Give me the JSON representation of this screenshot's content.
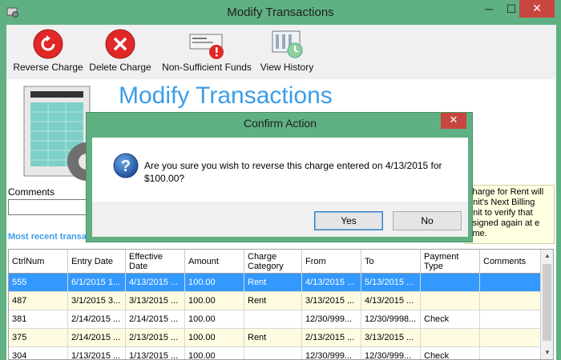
{
  "window": {
    "title": "Modify Transactions",
    "minimize": "─",
    "maximize": "☐",
    "close": "✕"
  },
  "toolbar": {
    "reverse_label": "Reverse Charge",
    "delete_label": "Delete Charge",
    "nsf_label": "Non-Sufficient Funds",
    "history_label": "View History"
  },
  "heading": "Modify Transactions",
  "comments_label": "Comments",
  "recent_label": "Most recent transactions",
  "info_text": "charge for Rent will unit's Next Billing unit to verify that ssigned again at e time.",
  "grid": {
    "columns": [
      "CtrlNum",
      "Entry Date",
      "Effective Date",
      "Amount",
      "Charge Category",
      "From",
      "To",
      "Payment Type",
      "Comments"
    ],
    "rows": [
      [
        "555",
        "6/1/2015 1...",
        "4/13/2015 ...",
        "100.00",
        "Rent",
        "4/13/2015 ...",
        "5/13/2015 ...",
        "",
        ""
      ],
      [
        "487",
        "3/1/2015 3...",
        "3/13/2015 ...",
        "100.00",
        "Rent",
        "3/13/2015 ...",
        "4/13/2015 ...",
        "",
        ""
      ],
      [
        "381",
        "2/14/2015 ...",
        "2/14/2015 ...",
        "100.00",
        "",
        "12/30/999...",
        "12/30/9998...",
        "Check",
        ""
      ],
      [
        "375",
        "2/14/2015 ...",
        "2/13/2015 ...",
        "100.00",
        "Rent",
        "2/13/2015 ...",
        "3/13/2015 ...",
        "",
        ""
      ],
      [
        "304",
        "1/13/2015 ...",
        "1/13/2015 ...",
        "100.00",
        "",
        "12/30/999...",
        "12/30/999...",
        "Check",
        ""
      ]
    ]
  },
  "dialog": {
    "title": "Confirm Action",
    "close": "✕",
    "message": "Are you sure you wish to reverse this charge entered on 4/13/2015 for $100.00?",
    "yes_label": "Yes",
    "no_label": "No"
  },
  "colors": {
    "accent": "#3b9de8",
    "window_frame": "#5fb082",
    "close": "#c7463f",
    "selection": "#3399ff"
  }
}
